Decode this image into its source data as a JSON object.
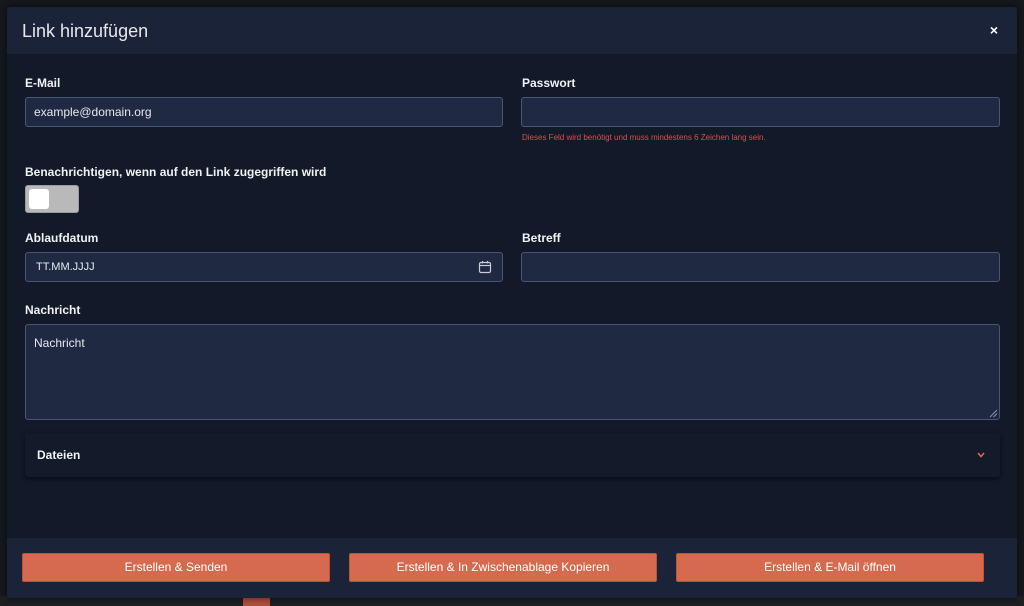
{
  "dialog": {
    "title": "Link hinzufügen",
    "close_label": "×"
  },
  "form": {
    "email": {
      "label": "E-Mail",
      "value": "example@domain.org"
    },
    "password": {
      "label": "Passwort",
      "value": "",
      "error": "Dieses Feld wird benötigt und muss mindestens 6 Zeichen lang sein."
    },
    "notify": {
      "label": "Benachrichtigen, wenn auf den Link zugegriffen wird",
      "enabled": false
    },
    "expiry": {
      "label": "Ablaufdatum",
      "placeholder": "TT.MM.JJJJ",
      "icon": "calendar-icon"
    },
    "subject": {
      "label": "Betreff",
      "value": ""
    },
    "message": {
      "label": "Nachricht",
      "placeholder": "Nachricht"
    },
    "files": {
      "label": "Dateien",
      "icon": "chevron-down-icon"
    }
  },
  "footer": {
    "create_send": "Erstellen & Senden",
    "create_copy": "Erstellen & In Zwischenablage Kopieren",
    "create_email": "Erstellen & E-Mail öffnen"
  },
  "colors": {
    "accent": "#d66a4f",
    "error": "#e24c4c",
    "panel": "#121928",
    "input_bg": "#1f2a42"
  }
}
